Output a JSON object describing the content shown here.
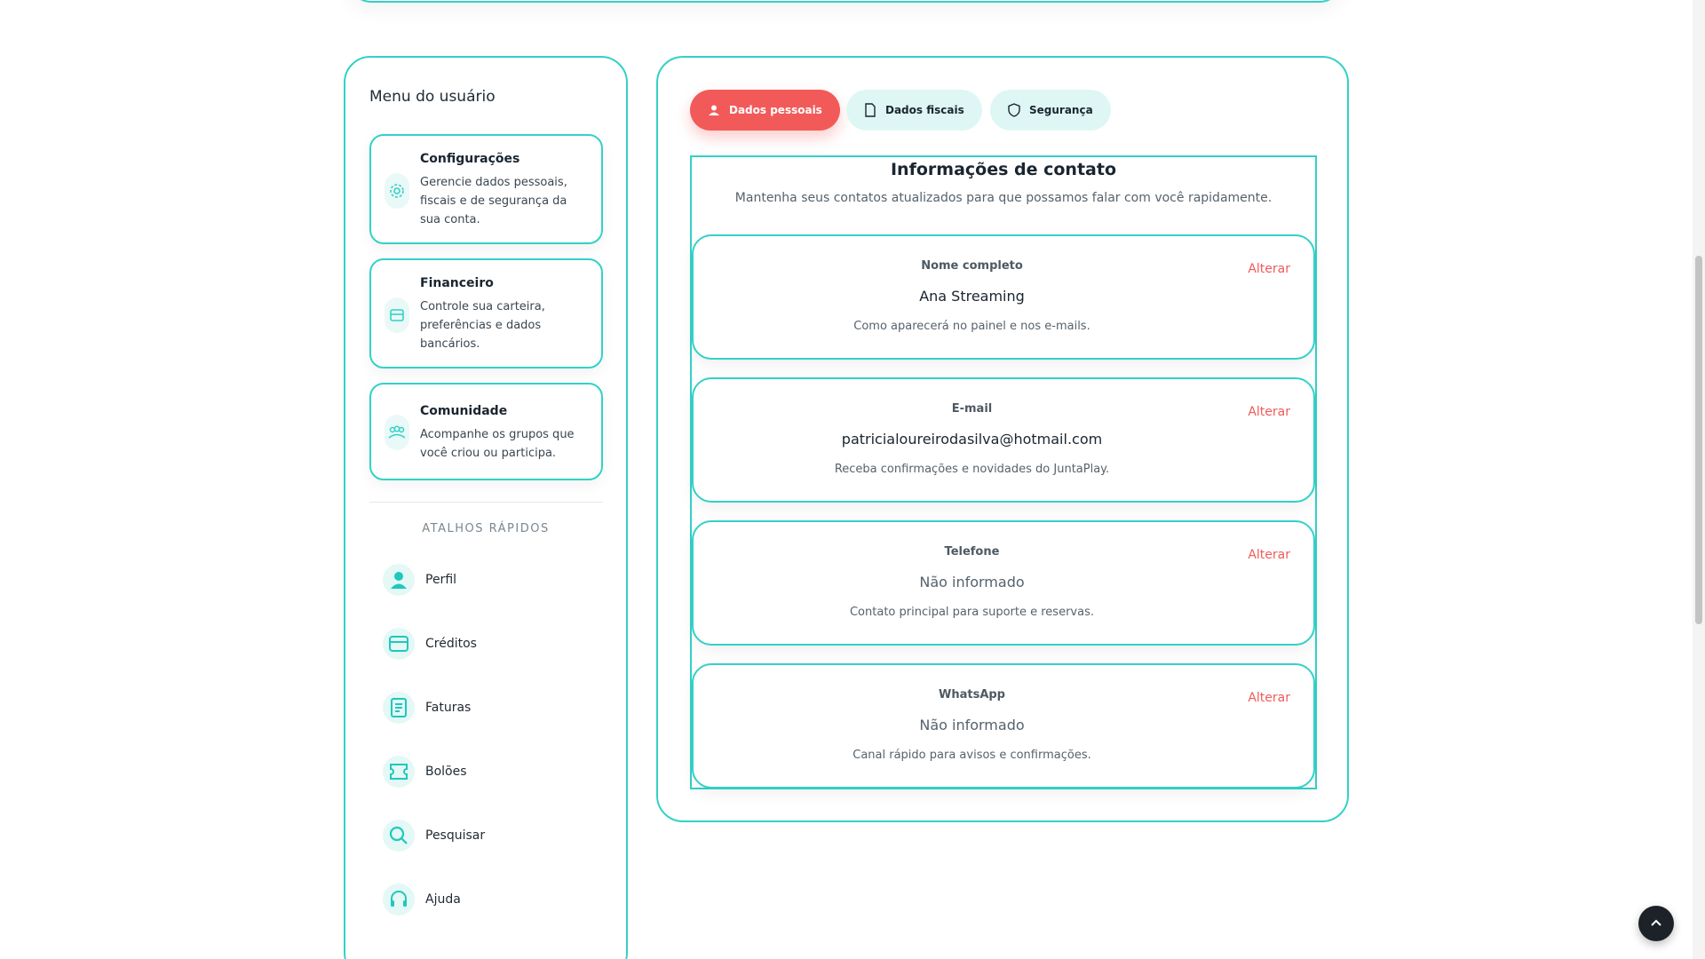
{
  "sidebar": {
    "title": "Menu do usuário",
    "menu": [
      {
        "title": "Configurações",
        "description": "Gerencie dados pessoais, fiscais e de segurança da sua conta.",
        "icon": "settings-icon"
      },
      {
        "title": "Financeiro",
        "description": "Controle sua carteira, preferências e dados bancários.",
        "icon": "wallet-icon"
      },
      {
        "title": "Comunidade",
        "description": "Acompanhe os grupos que você criou ou participa.",
        "icon": "community-icon"
      }
    ],
    "shortcuts_title": "ATALHOS RÁPIDOS",
    "shortcuts": [
      {
        "label": "Perfil",
        "icon": "user-icon"
      },
      {
        "label": "Créditos",
        "icon": "wallet-icon"
      },
      {
        "label": "Faturas",
        "icon": "invoice-icon"
      },
      {
        "label": "Bolões",
        "icon": "ticket-icon"
      },
      {
        "label": "Pesquisar",
        "icon": "search-icon"
      },
      {
        "label": "Ajuda",
        "icon": "headset-icon"
      }
    ]
  },
  "tabs": [
    {
      "label": "Dados pessoais",
      "icon": "user-icon",
      "active": true
    },
    {
      "label": "Dados fiscais",
      "icon": "document-icon",
      "active": false
    },
    {
      "label": "Segurança",
      "icon": "shield-icon",
      "active": false
    }
  ],
  "contact": {
    "title": "Informações de contato",
    "subtitle": "Mantenha seus contatos atualizados para que possamos falar com você rapidamente.",
    "fields": [
      {
        "label": "Nome completo",
        "value": "Ana Streaming",
        "hint": "Como aparecerá no painel e nos e-mails.",
        "action": "Alterar"
      },
      {
        "label": "E-mail",
        "value": "patricialoureirodasilva@hotmail.com",
        "hint": "Receba confirmações e novidades do JuntaPlay.",
        "action": "Alterar"
      },
      {
        "label": "Telefone",
        "value": "Não informado",
        "hint": "Contato principal para suporte e reservas.",
        "action": "Alterar"
      },
      {
        "label": "WhatsApp",
        "value": "Não informado",
        "hint": "Canal rápido para avisos e confirmações.",
        "action": "Alterar"
      }
    ]
  },
  "colors": {
    "accent": "#33d1c7",
    "danger": "#f25a5a",
    "dark": "#1c2227"
  }
}
